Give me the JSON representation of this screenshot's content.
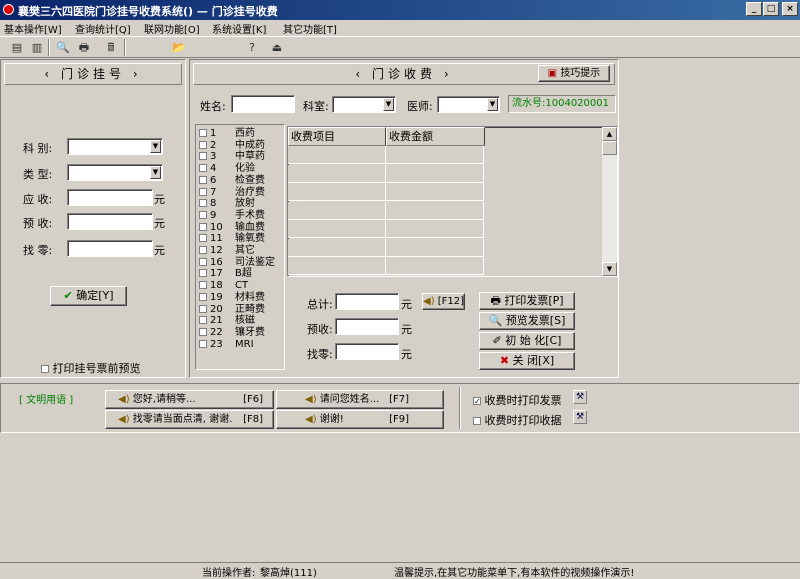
{
  "window": {
    "title": "襄樊三六四医院门诊挂号收费系统() — 门诊挂号收费",
    "min_label": "_",
    "max_label": "□",
    "close_label": "×"
  },
  "menu": {
    "items": [
      "基本操作[W]",
      "查询统计[Q]",
      "联网功能[O]",
      "系统设置[K]",
      "其它功能[T]"
    ]
  },
  "toolbar": {
    "icons": [
      "▤",
      "▥",
      "🔍",
      "🖶",
      "🖩",
      "📂",
      "?",
      "⏏"
    ]
  },
  "registration": {
    "header": "门诊挂号",
    "fields": {
      "dept_label": "科  别:",
      "type_label": "类  型:",
      "due_label": "应  收:",
      "prepaid_label": "预  收:",
      "change_label": "找  零:",
      "unit": "元"
    },
    "confirm_button": "确定[Y]",
    "preview_label": "打印挂号票前预览"
  },
  "charge": {
    "header": "门诊收费",
    "tips_button": "技巧提示",
    "name_label": "姓名:",
    "dept_label": "科室:",
    "doctor_label": "医师:",
    "serial": "流水号:1004020001",
    "categories": [
      {
        "code": "1",
        "name": "西药"
      },
      {
        "code": "2",
        "name": "中成药"
      },
      {
        "code": "3",
        "name": "中草药"
      },
      {
        "code": "4",
        "name": "化验"
      },
      {
        "code": "6",
        "name": "检查费"
      },
      {
        "code": "7",
        "name": "治疗费"
      },
      {
        "code": "8",
        "name": "放射"
      },
      {
        "code": "9",
        "name": "手术费"
      },
      {
        "code": "10",
        "name": "输血费"
      },
      {
        "code": "11",
        "name": "输氧费"
      },
      {
        "code": "12",
        "name": "其它"
      },
      {
        "code": "16",
        "name": "司法鉴定"
      },
      {
        "code": "17",
        "name": "B超"
      },
      {
        "code": "18",
        "name": "CT"
      },
      {
        "code": "19",
        "name": "材料费"
      },
      {
        "code": "20",
        "name": "正畸费"
      },
      {
        "code": "21",
        "name": "核磁"
      },
      {
        "code": "22",
        "name": "镶牙费"
      },
      {
        "code": "23",
        "name": "MRI"
      }
    ],
    "table": {
      "columns": [
        "收费项目",
        "收费金额"
      ]
    },
    "total_label": "总计:",
    "prepaid_label": "预收:",
    "change_label": "找零:",
    "unit": "元",
    "f12_label": "[F12]",
    "buttons": {
      "print_invoice": "打印发票[P]",
      "preview_invoice": "预览发票[S]",
      "initialize": "初 始 化[C]",
      "close": "关    闭[X]"
    }
  },
  "phrases": {
    "label": "[ 文明用语 ]",
    "items": [
      {
        "text": "您好,请稍等...",
        "key": "[F6]"
      },
      {
        "text": "请问您姓名...",
        "key": "[F7]"
      },
      {
        "text": "找零请当面点清, 谢谢.",
        "key": "[F8]"
      },
      {
        "text": "谢谢!",
        "key": "[F9]"
      }
    ]
  },
  "options": {
    "print_invoice_on_charge": "收费时打印发票",
    "print_receipt_on_charge": "收费时打印收据"
  },
  "status": {
    "operator_label": "当前操作者:",
    "operator": "黎高焯(111)",
    "hint": "温馨提示,在其它功能菜单下,有本软件的视频操作演示!"
  }
}
